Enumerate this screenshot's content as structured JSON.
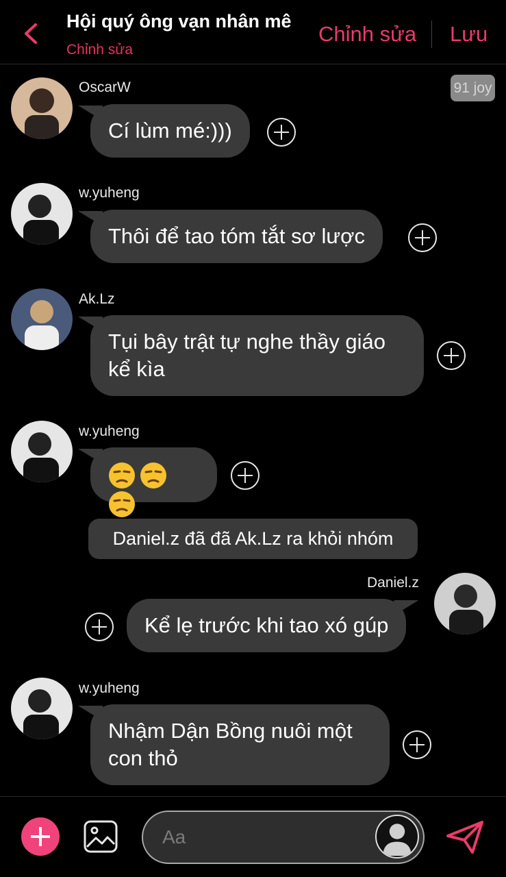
{
  "header": {
    "title": "Hội quý ông vạn nhân mê",
    "subtitle": "Chỉnh sửa",
    "edit_label": "Chỉnh sửa",
    "save_label": "Lưu"
  },
  "badge": "91 joy",
  "messages": [
    {
      "sender": "OscarW",
      "text": "Cí lùm mé:)))"
    },
    {
      "sender": "w.yuheng",
      "text": "Thôi để tao tóm tắt sơ lược"
    },
    {
      "sender": "Ak.Lz",
      "text": "Tụi bây trật tự nghe thầy giáo kể kìa"
    },
    {
      "sender": "w.yuheng",
      "text": "😒😒😒"
    },
    {
      "sender": "Daniel.z",
      "text": "Kể lẹ trước khi tao xó gúp"
    },
    {
      "sender": "w.yuheng",
      "text": "Nhậm Dận Bồng nuôi một con thỏ"
    }
  ],
  "system_notice": "Daniel.z đã đã Ak.Lz ra khỏi nhóm",
  "composer": {
    "placeholder": "Aa"
  },
  "colors": {
    "accent": "#ea3b6a",
    "bubble": "#3a3a3a",
    "background": "#000000"
  }
}
